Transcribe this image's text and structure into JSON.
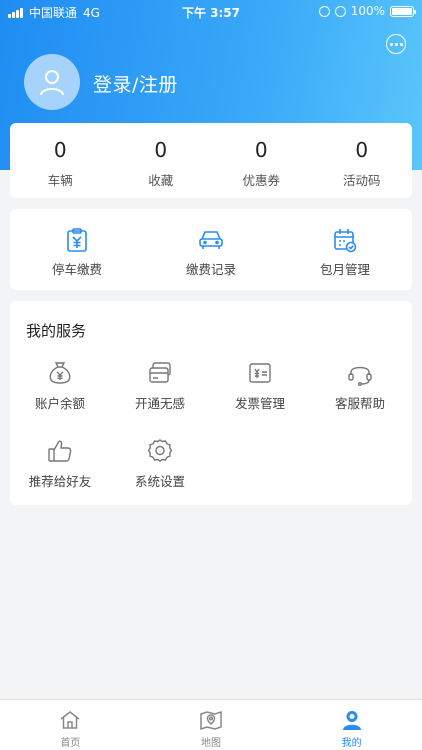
{
  "status_bar": {
    "carrier": "中国联通",
    "network": "4G",
    "time": "下午 3:57",
    "battery": "100%"
  },
  "header": {
    "login_label": "登录/注册",
    "icons": {
      "message": "chat-bubble-icon",
      "avatar": "user-icon"
    }
  },
  "stats": [
    {
      "value": "0",
      "label": "车辆"
    },
    {
      "value": "0",
      "label": "收藏"
    },
    {
      "value": "0",
      "label": "优惠券"
    },
    {
      "value": "0",
      "label": "活动码"
    }
  ],
  "quick_actions": [
    {
      "label": "停车缴费",
      "icon": "parking-pay-icon"
    },
    {
      "label": "缴费记录",
      "icon": "car-icon"
    },
    {
      "label": "包月管理",
      "icon": "calendar-check-icon"
    }
  ],
  "services": {
    "title": "我的服务",
    "items": [
      {
        "label": "账户余额",
        "icon": "money-bag-icon"
      },
      {
        "label": "开通无感",
        "icon": "card-icon"
      },
      {
        "label": "发票管理",
        "icon": "invoice-icon"
      },
      {
        "label": "客服帮助",
        "icon": "headset-icon"
      },
      {
        "label": "推荐给好友",
        "icon": "thumbs-up-icon"
      },
      {
        "label": "系统设置",
        "icon": "gear-icon"
      }
    ]
  },
  "tabbar": [
    {
      "label": "首页",
      "icon": "home-icon",
      "active": false
    },
    {
      "label": "地图",
      "icon": "map-icon",
      "active": false
    },
    {
      "label": "我的",
      "icon": "profile-icon",
      "active": true
    }
  ],
  "colors": {
    "accent": "#2a8cf0",
    "header_start": "#1f8cf2",
    "header_end": "#5ac6fb",
    "background": "#f3f4f6"
  }
}
